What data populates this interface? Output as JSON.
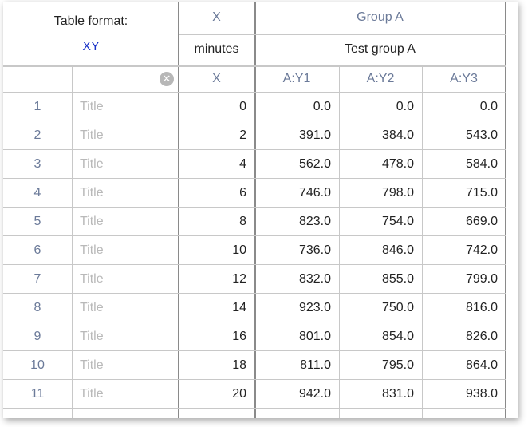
{
  "table": {
    "format_label": "Table format:",
    "format_value": "XY",
    "x_group": "X",
    "group_name": "Group A",
    "x_units": "minutes",
    "group_title": "Test group A",
    "col_x": "X",
    "col_y1": "A:Y1",
    "col_y2": "A:Y2",
    "col_y3": "A:Y3",
    "clear_icon": "clear-circle-icon",
    "rows": [
      {
        "num": "1",
        "title": "Title",
        "x": "0",
        "y1": "0.0",
        "y2": "0.0",
        "y3": "0.0"
      },
      {
        "num": "2",
        "title": "Title",
        "x": "2",
        "y1": "391.0",
        "y2": "384.0",
        "y3": "543.0"
      },
      {
        "num": "3",
        "title": "Title",
        "x": "4",
        "y1": "562.0",
        "y2": "478.0",
        "y3": "584.0"
      },
      {
        "num": "4",
        "title": "Title",
        "x": "6",
        "y1": "746.0",
        "y2": "798.0",
        "y3": "715.0"
      },
      {
        "num": "5",
        "title": "Title",
        "x": "8",
        "y1": "823.0",
        "y2": "754.0",
        "y3": "669.0"
      },
      {
        "num": "6",
        "title": "Title",
        "x": "10",
        "y1": "736.0",
        "y2": "846.0",
        "y3": "742.0"
      },
      {
        "num": "7",
        "title": "Title",
        "x": "12",
        "y1": "832.0",
        "y2": "855.0",
        "y3": "799.0"
      },
      {
        "num": "8",
        "title": "Title",
        "x": "14",
        "y1": "923.0",
        "y2": "750.0",
        "y3": "816.0"
      },
      {
        "num": "9",
        "title": "Title",
        "x": "16",
        "y1": "801.0",
        "y2": "854.0",
        "y3": "826.0"
      },
      {
        "num": "10",
        "title": "Title",
        "x": "18",
        "y1": "811.0",
        "y2": "795.0",
        "y3": "864.0"
      },
      {
        "num": "11",
        "title": "Title",
        "x": "20",
        "y1": "942.0",
        "y2": "831.0",
        "y3": "938.0"
      }
    ]
  }
}
